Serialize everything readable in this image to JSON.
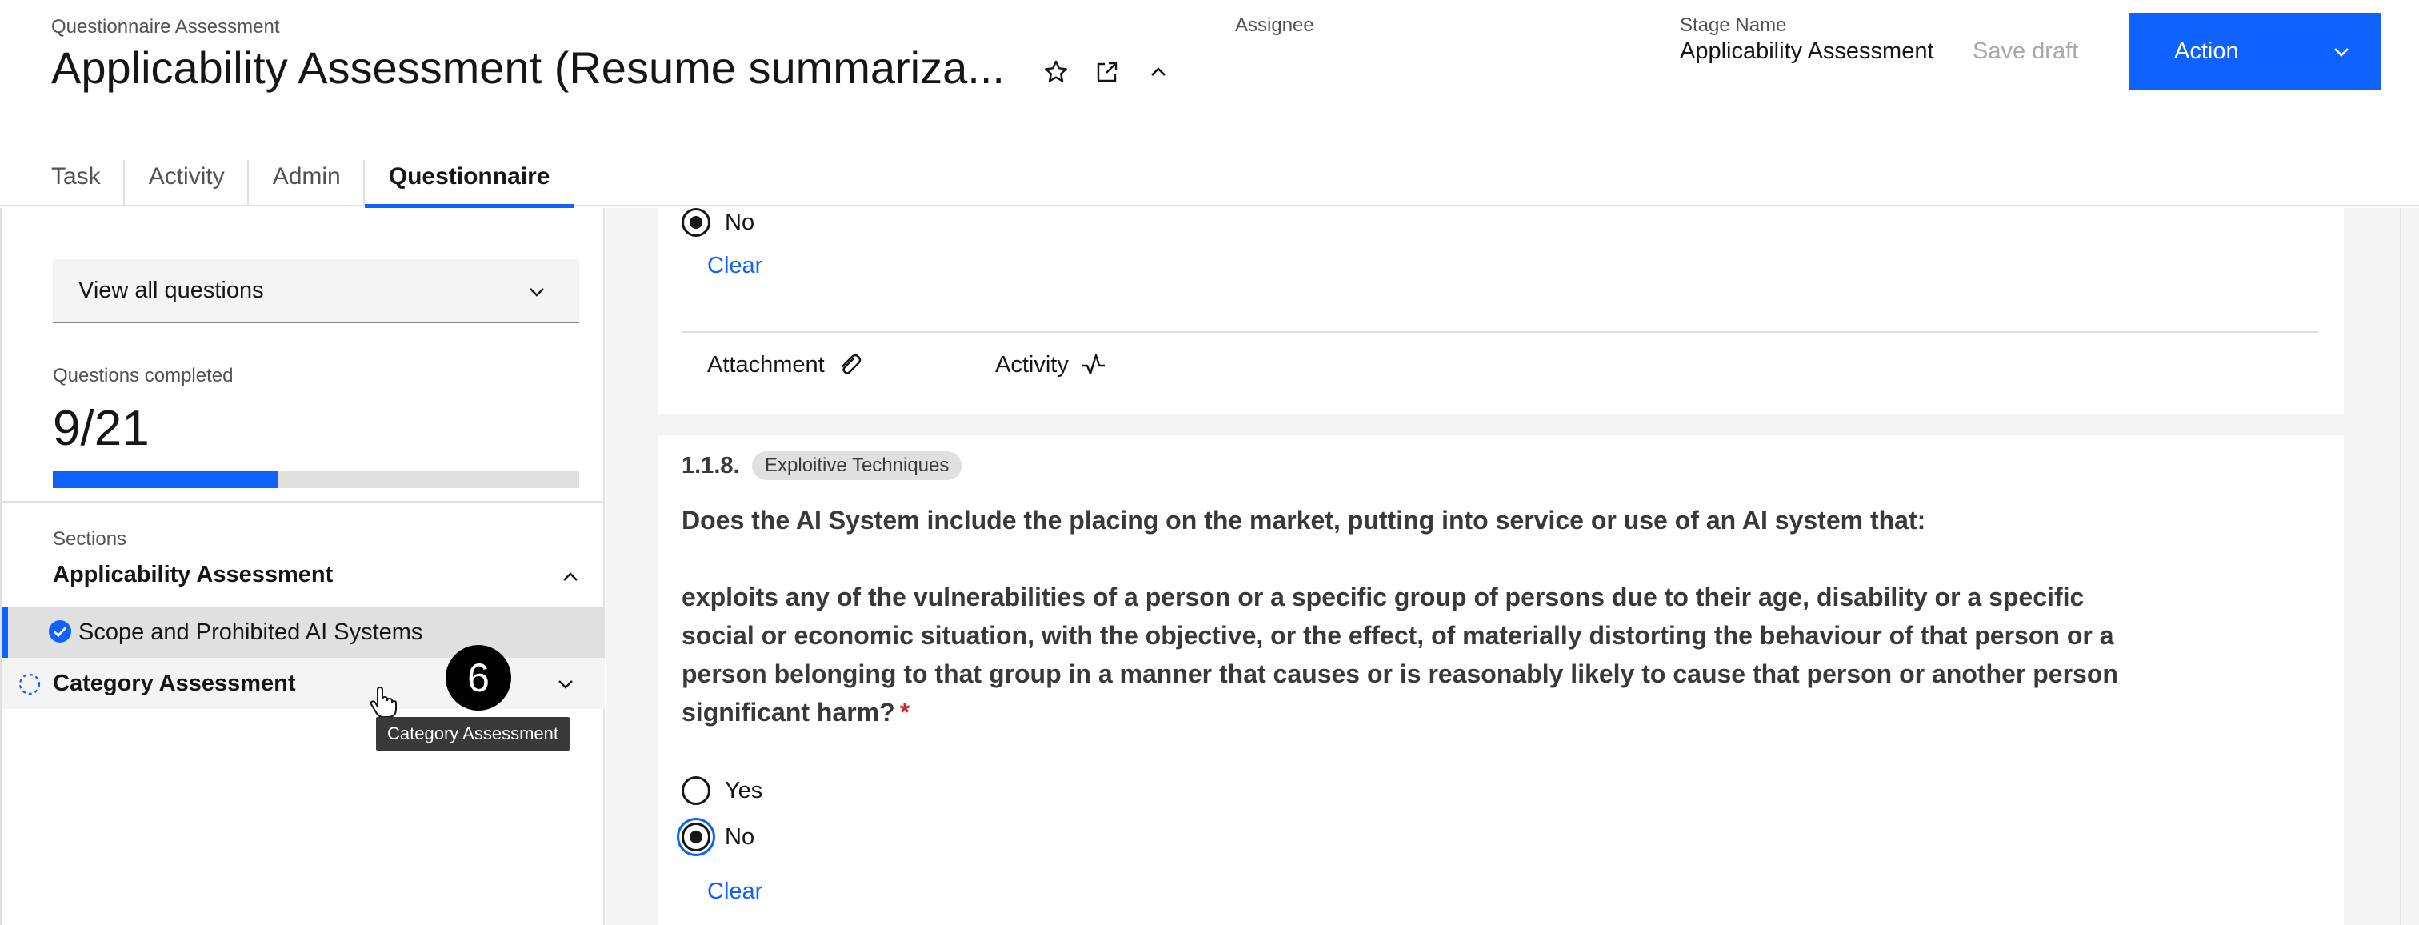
{
  "header": {
    "subtitle": "Questionnaire Assessment",
    "title": "Applicability Assessment (Resume summariza...",
    "assignee_label": "Assignee",
    "stage_label": "Stage Name",
    "stage_value": "Applicability Assessment",
    "save_draft_label": "Save draft",
    "action_label": "Action"
  },
  "tabs": [
    {
      "label": "Task"
    },
    {
      "label": "Activity"
    },
    {
      "label": "Admin"
    },
    {
      "label": "Questionnaire",
      "active": true
    }
  ],
  "sidebar": {
    "filter_value": "View all questions",
    "completed_label": "Questions completed",
    "completed_value": "9/21",
    "progress_fraction": 0.4286,
    "sections_label": "Sections",
    "sections": [
      {
        "label": "Applicability Assessment",
        "expanded": true,
        "items": [
          {
            "label": "Scope and Prohibited AI Systems",
            "completed": true,
            "selected": true
          }
        ]
      },
      {
        "label": "Category Assessment",
        "expanded": false
      }
    ]
  },
  "overlay": {
    "step_number": "6",
    "tooltip": "Category Assessment"
  },
  "question_prev": {
    "selected_option": "No",
    "clear_label": "Clear",
    "attachment_label": "Attachment",
    "activity_label": "Activity"
  },
  "question": {
    "number": "1.1.8.",
    "tag": "Exploitive Techniques",
    "text_line1": "Does the AI System include the placing on the market, putting into service or use of an AI system that:",
    "text_line2": "exploits any of the vulnerabilities of a person or a specific group of persons due to their age, disability or a specific social or economic situation, with the objective, or the effect, of materially distorting the behaviour of that person or a person belonging to that group in a manner that causes or is reasonably likely to cause that person or another person significant harm?",
    "required_mark": "*",
    "options": [
      {
        "label": "Yes",
        "selected": false
      },
      {
        "label": "No",
        "selected": true
      }
    ],
    "clear_label": "Clear"
  },
  "colors": {
    "primary": "#0f62fe",
    "required": "#da1e28",
    "disabled_text": "#a8a8a8"
  }
}
